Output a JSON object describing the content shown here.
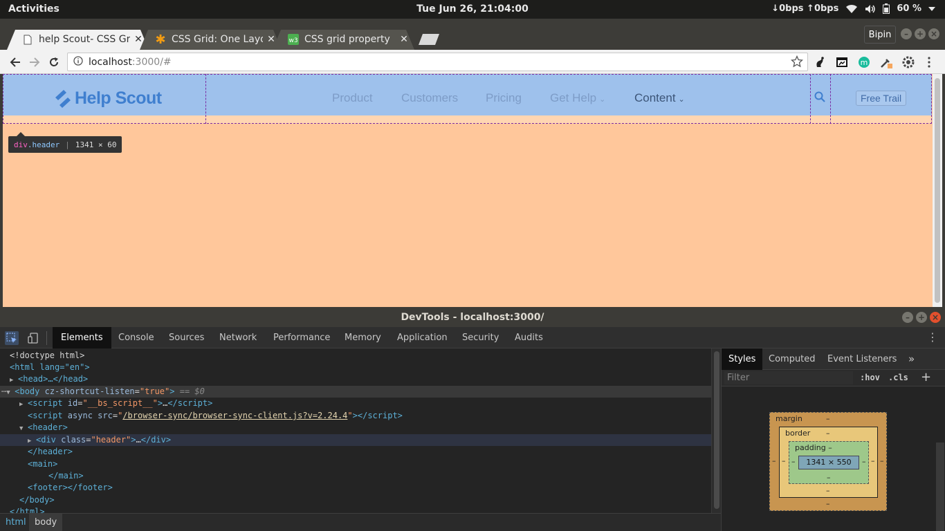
{
  "system_bar": {
    "activities": "Activities",
    "clock": "Tue Jun 26, 21:04:00",
    "net_speed": "↓0bps ↑0bps",
    "battery": "60 %"
  },
  "browser": {
    "tabs": [
      {
        "title": "help Scout- CSS Grid",
        "favicon": "page-icon",
        "active": true
      },
      {
        "title": "CSS Grid: One Layout",
        "favicon": "asterisk-icon",
        "active": false
      },
      {
        "title": "CSS grid property",
        "favicon": "w3-icon",
        "active": false
      }
    ],
    "profile": "Bipin",
    "url": {
      "scheme_icon": "info-icon",
      "host": "localhost",
      "path": ":3000/#"
    }
  },
  "site": {
    "logo_text": "Help Scout",
    "nav": [
      {
        "label": "Product",
        "chevron": false
      },
      {
        "label": "Customers",
        "chevron": false
      },
      {
        "label": "Pricing",
        "chevron": false
      },
      {
        "label": "Get Help",
        "chevron": true
      },
      {
        "label": "Content",
        "chevron": true
      }
    ],
    "cta": "Free Trail",
    "tooltip": {
      "tag": "div",
      "cls": ".header",
      "size": "1341 × 60"
    }
  },
  "devtools": {
    "title": "DevTools - localhost:3000/",
    "tabs": [
      "Elements",
      "Console",
      "Sources",
      "Network",
      "Performance",
      "Memory",
      "Application",
      "Security",
      "Audits"
    ],
    "active_tab": "Elements",
    "dom": {
      "doctype": "<!doctype html>",
      "html_open": "<html lang=\"en\">",
      "head": "<head>…</head>",
      "body_tag": "body",
      "body_attr": "cz-shortcut-listen",
      "body_val": "\"true\"",
      "body_suffix": "== $0",
      "script1_attr": "id",
      "script1_val": "\"__bs_script__\"",
      "script2_attr": "async src",
      "script2_val": "/browser-sync/browser-sync-client.js?v=2.24.4",
      "header_open": "<header>",
      "div_attr": "class",
      "div_val": "\"header\"",
      "header_close": "</header>",
      "main_open": "<main>",
      "main_close": "</main>",
      "footer": "<footer></footer>",
      "body_close": "</body>",
      "html_close": "</html>"
    },
    "breadcrumb": [
      "html",
      "body"
    ],
    "sidebar_tabs": [
      "Styles",
      "Computed",
      "Event Listeners"
    ],
    "filter_placeholder": "Filter",
    "hov": ":hov",
    "cls": ".cls",
    "box_model": {
      "margin_label": "margin",
      "border_label": "border",
      "padding_label": "padding",
      "content_size": "1341 × 550",
      "dash": "–"
    }
  }
}
